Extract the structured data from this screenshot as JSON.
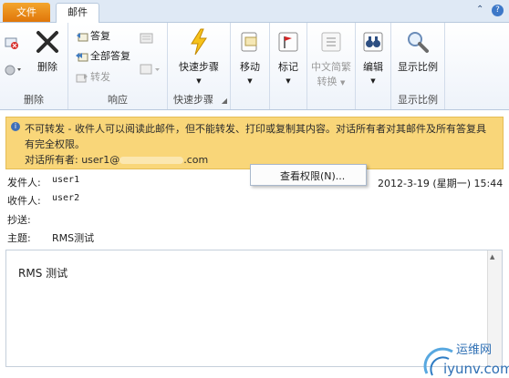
{
  "tabs": {
    "file": "文件",
    "mail": "邮件"
  },
  "window": {
    "minimize": "⌃",
    "help": "?"
  },
  "ribbon": {
    "delete_group": {
      "label": "删除",
      "delete_btn": "删除"
    },
    "respond_group": {
      "label": "响应",
      "reply": "答复",
      "reply_all": "全部答复",
      "forward": "转发"
    },
    "quicksteps_group": {
      "label": "快速步骤",
      "quicksteps_btn": "快速步骤"
    },
    "move_btn": "移动",
    "tags_btn": "标记",
    "chinese_btn_line1": "中文简繁",
    "chinese_btn_line2": "转换",
    "edit_btn": "编辑",
    "zoom_group": {
      "label": "显示比例",
      "zoom_btn": "显示比例"
    }
  },
  "infobar": {
    "line1": "不可转发 - 收件人可以阅读此邮件，但不能转发、打印或复制其内容。对话所有者对其邮件及所有答复具",
    "line2": "有完全权限。",
    "line3_prefix": "对话所有者: user1@",
    "line3_suffix": ".com"
  },
  "context_menu": {
    "view_permission": "查看权限(N)..."
  },
  "header": {
    "from_label": "发件人:",
    "from_value": "user1",
    "to_label": "收件人:",
    "to_value": "user2",
    "cc_label": "抄送:",
    "subject_label": "主题:",
    "subject_value": "RMS测试",
    "date": "2012-3-19 (星期一) 15:44"
  },
  "body": {
    "text": "RMS 测试"
  },
  "watermark": {
    "text1": "运维网",
    "text2": "iyunv.com"
  },
  "colors": {
    "accent": "#e0760a",
    "infobar": "#f9d679",
    "ribbon_text": "#1e1e1e"
  }
}
